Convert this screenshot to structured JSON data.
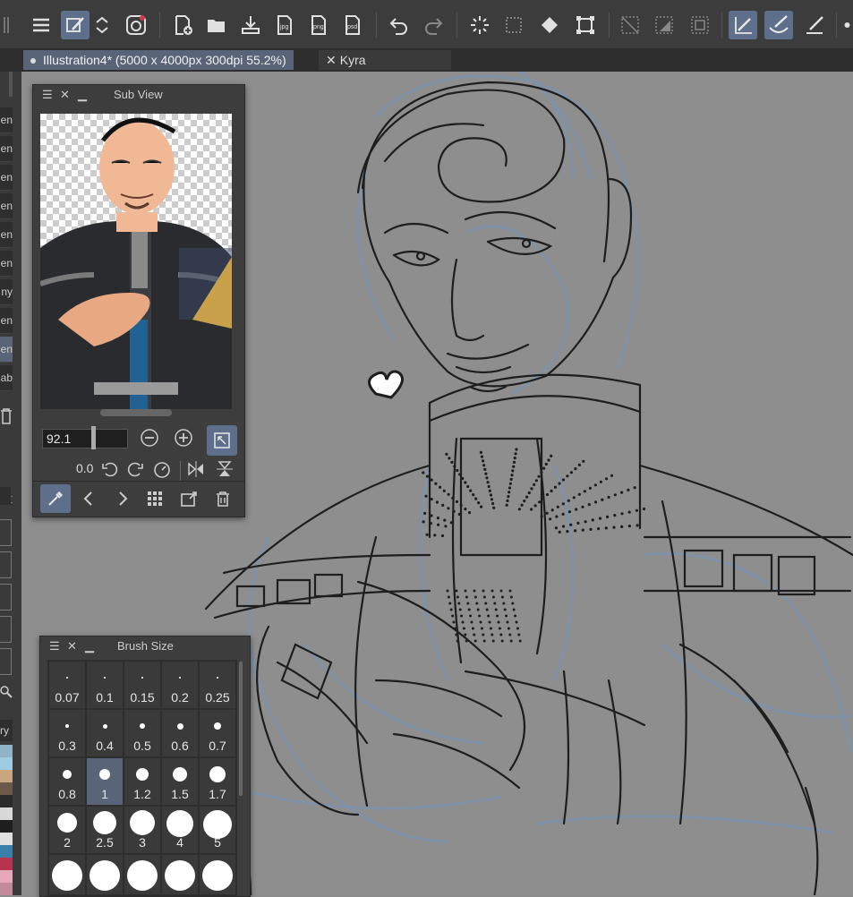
{
  "tabs": {
    "document": "Illustration4* (5000 x 4000px 300dpi 55.2%)",
    "other": "Kyra"
  },
  "layer_labels": [
    "en",
    "en",
    "en",
    "en",
    "en",
    "en",
    "ny",
    "en",
    "en",
    "ab"
  ],
  "layer_selected_index": 8,
  "material_label": "ry",
  "sub_view": {
    "title": "Sub View",
    "zoom_value": "92.1",
    "rotation_value": "0.0"
  },
  "brush_size": {
    "title": "Brush Size",
    "sizes": [
      "0.07",
      "0.1",
      "0.15",
      "0.2",
      "0.25",
      "0.3",
      "0.4",
      "0.5",
      "0.6",
      "0.7",
      "0.8",
      "1",
      "1.2",
      "1.5",
      "1.7",
      "2",
      "2.5",
      "3",
      "4",
      "5"
    ],
    "selected": "1"
  },
  "colors": {
    "accent": "#5d6f8a",
    "panel": "#3d3d3d",
    "canvas": "#8e8e8e",
    "sketch_black": "#1e1e1e",
    "sketch_blue": "#7d93ad"
  },
  "palette": [
    "#8fb3c9",
    "#9ecbe0",
    "#c8a77e",
    "#6b5a4a",
    "#2a2a2a",
    "#d8d8d8",
    "#1e1e1e",
    "#e0e0e0",
    "#3a7fa8",
    "#b8344e",
    "#e6a8b8",
    "#c48a9a"
  ]
}
